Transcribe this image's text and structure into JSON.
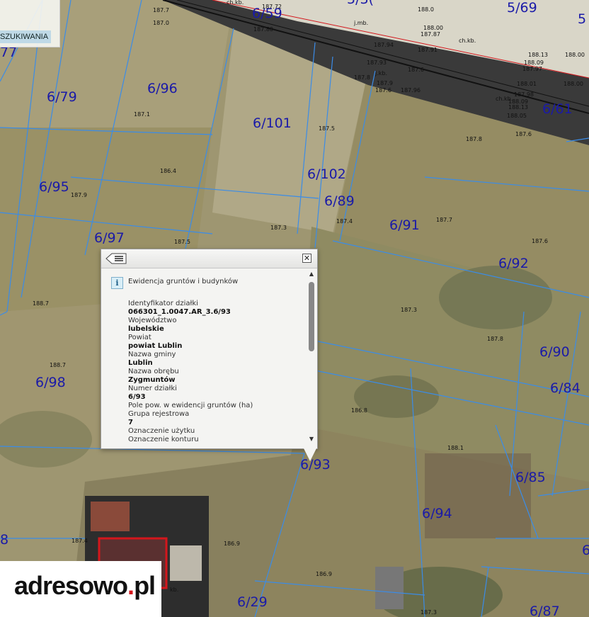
{
  "search": {
    "tag": "SZUKIWANIA"
  },
  "parcels": [
    "6/59",
    "5/69",
    "6/96",
    "6/79",
    "6/101",
    "6/102",
    "6/95",
    "6/89",
    "6/91",
    "6/97",
    "6/92",
    "6/90",
    "6/84",
    "6/98",
    "6/93",
    "6/85",
    "6/94",
    "6/29",
    "6/87",
    "6/61",
    "5/3(",
    "5",
    "77",
    "8",
    "6"
  ],
  "elevations": [
    "187.7",
    "187.0",
    "187.80",
    "187.72",
    "188.0",
    "188.00",
    "187.87",
    "187.91",
    "187.94",
    "188.13",
    "188.09",
    "187.97",
    "188.01",
    "188.00",
    "187.93",
    "187.8",
    "187.9",
    "187.6",
    "187.96",
    "187.98",
    "188.09",
    "188.05",
    "188.13",
    "187.6",
    "187.1",
    "187.5",
    "187.8",
    "186.4",
    "187.9",
    "187.4",
    "187.7",
    "187.3",
    "187.5",
    "187.6",
    "188.7",
    "188.7",
    "187.3",
    "187.8",
    "186.8",
    "188.1",
    "187.4",
    "186.9",
    "186.9",
    "187.3",
    "187.6",
    "188.00"
  ],
  "road_labels": [
    "ch.kb.",
    "j.mb.",
    "ch.kb.",
    "ch.kb.",
    "j.kb.",
    "kb."
  ],
  "popup": {
    "layer_title": "Ewidencja gruntów i budynków",
    "fields": [
      {
        "label": "Identyfikator działki",
        "value": "066301_1.0047.AR_3.6/93"
      },
      {
        "label": "Województwo",
        "value": "lubelskie"
      },
      {
        "label": "Powiat",
        "value": "powiat Lublin"
      },
      {
        "label": "Nazwa gminy",
        "value": "Lublin"
      },
      {
        "label": "Nazwa obrębu",
        "value": "Zygmuntów"
      },
      {
        "label": "Numer działki",
        "value": "6/93"
      },
      {
        "label": "Pole pow. w ewidencji gruntów (ha)",
        "value": ""
      },
      {
        "label": "Grupa rejestrowa",
        "value": "7"
      },
      {
        "label": "Oznaczenie użytku",
        "value": ""
      },
      {
        "label": "Oznaczenie konturu",
        "value": ""
      }
    ],
    "close_glyph": "✕",
    "info_glyph": "i",
    "scroll_up": "▲",
    "scroll_down": "▼"
  },
  "logo": {
    "text_main": "adresowo",
    "text_dot": ".",
    "text_tld": "pl"
  },
  "icons": {
    "menu": "menu-list-icon",
    "close": "close-icon",
    "info": "info-icon"
  },
  "colors": {
    "parcel_line": "#3a8ce8",
    "parcel_label": "#1a1aa8",
    "road": "#2b2b2b",
    "accent_red": "#d4161c"
  }
}
